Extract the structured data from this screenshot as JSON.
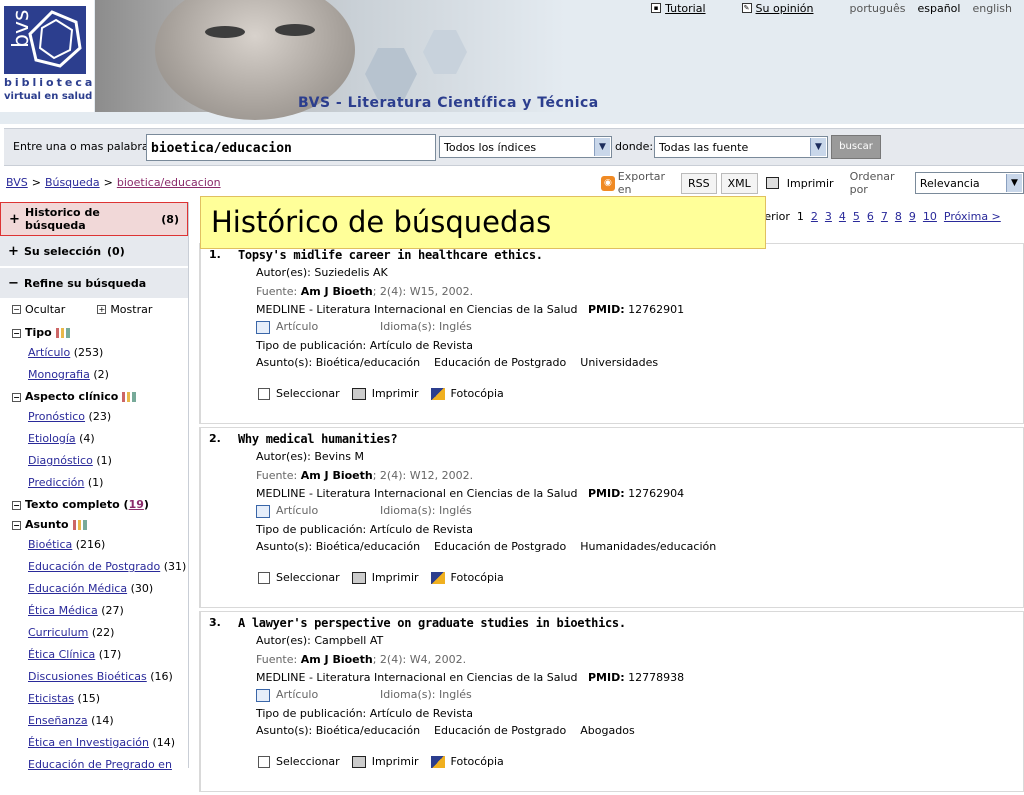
{
  "header": {
    "logo_text": "bvs",
    "logo_line1": "biblioteca",
    "logo_line2": "virtual en salud",
    "site_title": "BVS - Literatura Científica y Técnica",
    "tutorial": "Tutorial",
    "opinion": "Su opinión",
    "languages": [
      "português",
      "español",
      "english"
    ]
  },
  "search": {
    "label": "Entre una o mas palabras",
    "query": "bioetica/educacion",
    "index_select": "Todos los índices",
    "donde_label": "donde:",
    "source_select": "Todas las fuente",
    "button": "buscar"
  },
  "breadcrumb": [
    "BVS",
    "Búsqueda",
    "bioetica/educacion"
  ],
  "toolbar": {
    "export_label": "Exportar en",
    "rss": "RSS",
    "xml": "XML",
    "print": "Imprimir",
    "order_label": "Ordenar por",
    "order_value": "Relevancia"
  },
  "sidebar": {
    "historico": "Historico de búsqueda",
    "historico_count": "(8)",
    "seleccion": "Su selección",
    "seleccion_count": "(0)",
    "refine": "Refine su búsqueda",
    "ocultar": "Ocultar",
    "mostrar": "Mostrar",
    "facets": [
      {
        "title": "Tipo",
        "items": [
          {
            "label": "Artículo",
            "count": "(253)"
          },
          {
            "label": "Monografia",
            "count": "(2)"
          }
        ]
      },
      {
        "title": "Aspecto clínico",
        "items": [
          {
            "label": "Pronóstico",
            "count": "(23)"
          },
          {
            "label": "Etiología",
            "count": "(4)"
          },
          {
            "label": "Diagnóstico",
            "count": "(1)"
          },
          {
            "label": "Predicción",
            "count": "(1)"
          }
        ]
      },
      {
        "title": "Texto completo",
        "title_count": "19",
        "items": []
      },
      {
        "title": "Asunto",
        "items": [
          {
            "label": "Bioética",
            "count": "(216)"
          },
          {
            "label": "Educación de Postgrado",
            "count": "(31)"
          },
          {
            "label": "Educación Médica",
            "count": "(30)"
          },
          {
            "label": "Ética Médica",
            "count": "(27)"
          },
          {
            "label": "Curriculum",
            "count": "(22)"
          },
          {
            "label": "Ética Clínica",
            "count": "(17)"
          },
          {
            "label": "Discusiones Bioéticas",
            "count": "(16)"
          },
          {
            "label": "Eticistas",
            "count": "(15)"
          },
          {
            "label": "Enseñanza",
            "count": "(14)"
          },
          {
            "label": "Ética en Investigación",
            "count": "(14)"
          },
          {
            "label": "Educación de Pregrado en",
            "count": ""
          }
        ]
      }
    ]
  },
  "callout": "Histórico de búsquedas",
  "pager": {
    "prev": "terior",
    "pages": [
      "1",
      "2",
      "3",
      "4",
      "5",
      "6",
      "7",
      "8",
      "9",
      "10"
    ],
    "next": "Próxima >"
  },
  "labels": {
    "autor": "Autor(es):",
    "fuente": "Fuente:",
    "idioma": "Idioma(s):",
    "tipo_pub": "Tipo de publicación:",
    "asunto": "Asunto(s):",
    "articulo_link": "Artículo",
    "pmid": "PMID:",
    "seleccionar": "Seleccionar",
    "imprimir": "Imprimir",
    "fotocopia": "Fotocópia"
  },
  "results": [
    {
      "num": "1.",
      "title": "Topsy's midlife career in healthcare ethics.",
      "authors": "Suziedelis AK",
      "journal": "Am J Bioeth",
      "source_rest": "; 2(4): W15, 2002.",
      "database": "MEDLINE - Literatura Internacional en Ciencias de la Salud",
      "pmid": "12762901",
      "language": "Inglés",
      "pub_type": "Artículo de Revista",
      "subjects": [
        "Bioética/educación",
        "Educación de Postgrado",
        "Universidades"
      ]
    },
    {
      "num": "2.",
      "title": "Why medical humanities?",
      "authors": "Bevins M",
      "journal": "Am J Bioeth",
      "source_rest": "; 2(4): W12, 2002.",
      "database": "MEDLINE - Literatura Internacional en Ciencias de la Salud",
      "pmid": "12762904",
      "language": "Inglés",
      "pub_type": "Artículo de Revista",
      "subjects": [
        "Bioética/educación",
        "Educación de Postgrado",
        "Humanidades/educación"
      ]
    },
    {
      "num": "3.",
      "title": "A lawyer's perspective on graduate studies in bioethics.",
      "authors": "Campbell AT",
      "journal": "Am J Bioeth",
      "source_rest": "; 2(4): W4, 2002.",
      "database": "MEDLINE - Literatura Internacional en Ciencias de la Salud",
      "pmid": "12778938",
      "language": "Inglés",
      "pub_type": "Artículo de Revista",
      "subjects": [
        "Bioética/educación",
        "Educación de Postgrado",
        "Abogados"
      ]
    }
  ]
}
